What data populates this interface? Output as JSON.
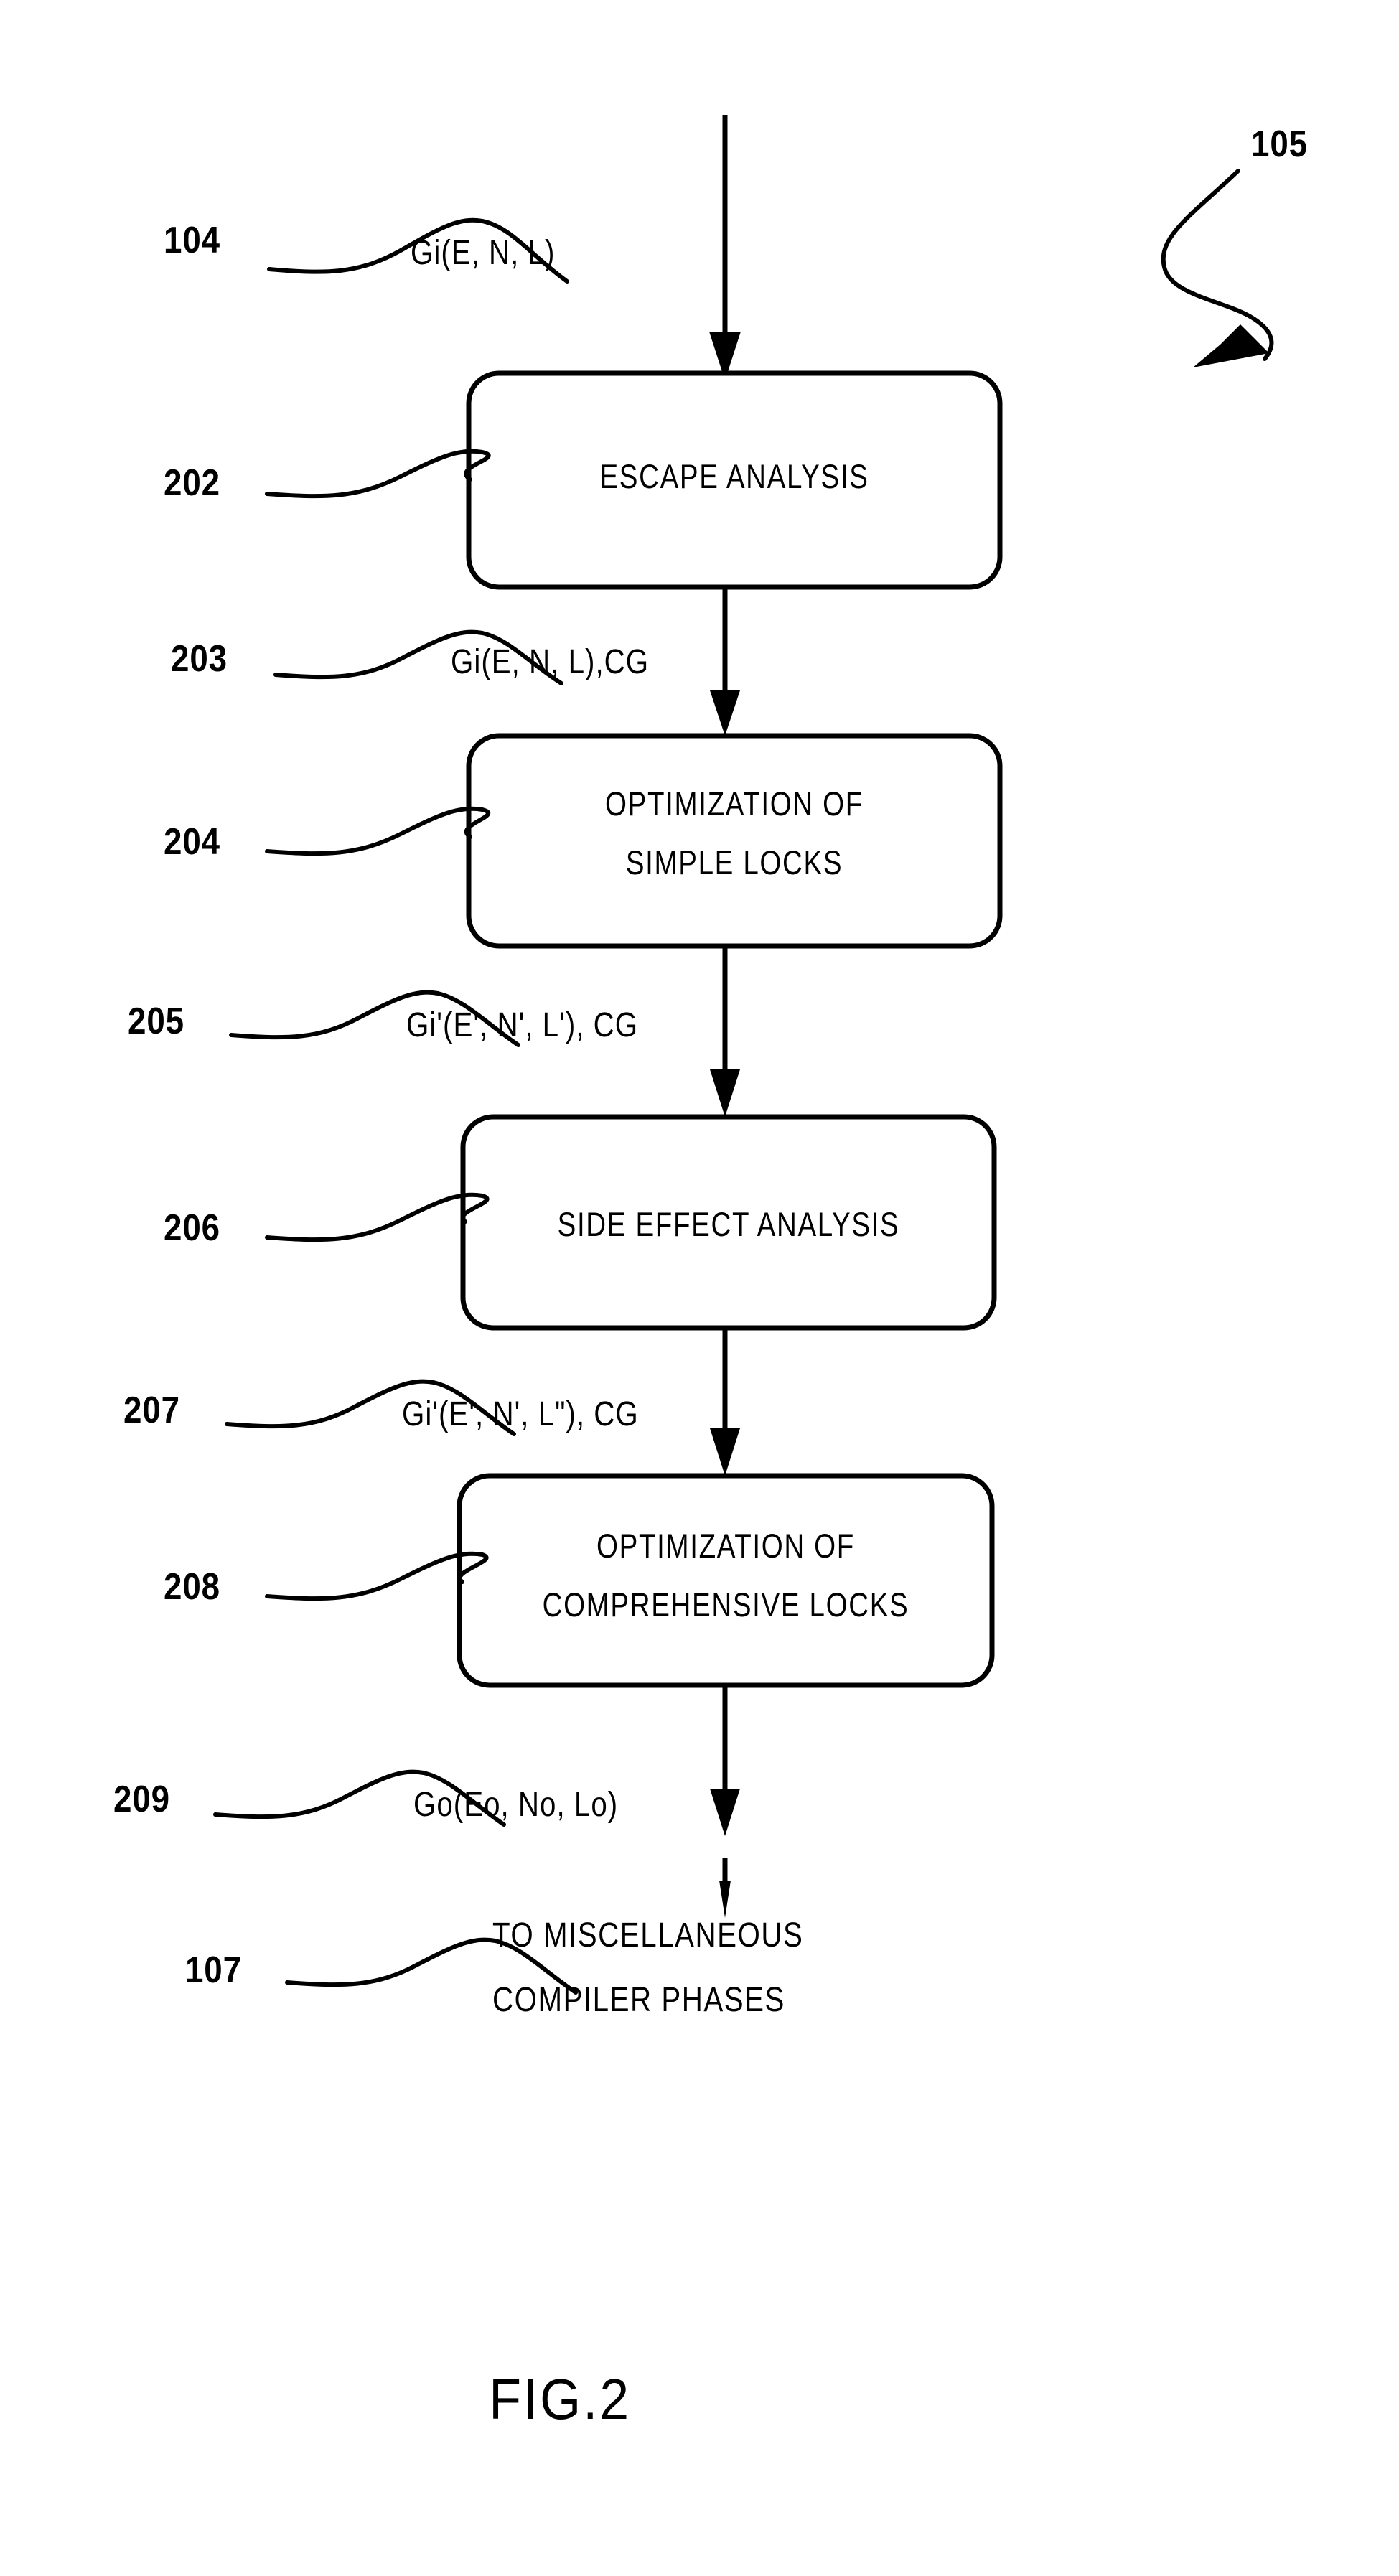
{
  "figure": {
    "caption": "FIG.2",
    "overall_ref": "105"
  },
  "inputs": {
    "ref": "104",
    "label": "Gi(E, N, L)"
  },
  "steps": [
    {
      "ref": "202",
      "lines": [
        "ESCAPE ANALYSIS"
      ]
    },
    {
      "ref": "204",
      "lines": [
        "OPTIMIZATION OF",
        "SIMPLE LOCKS"
      ]
    },
    {
      "ref": "206",
      "lines": [
        "SIDE EFFECT ANALYSIS"
      ]
    },
    {
      "ref": "208",
      "lines": [
        "OPTIMIZATION OF",
        "COMPREHENSIVE LOCKS"
      ]
    }
  ],
  "edges": [
    {
      "ref": "203",
      "label": "Gi(E, N, L),CG"
    },
    {
      "ref": "205",
      "label": "Gi'(E', N', L'), CG"
    },
    {
      "ref": "207",
      "label": "Gi'(E', N', L\"), CG"
    },
    {
      "ref": "209",
      "label": "Go(Eo, No, Lo)"
    }
  ],
  "terminal": {
    "ref": "107",
    "lines": [
      "TO MISCELLANEOUS",
      "COMPILER PHASES"
    ]
  },
  "colors": {
    "ink": "#000000",
    "paper": "#ffffff"
  }
}
